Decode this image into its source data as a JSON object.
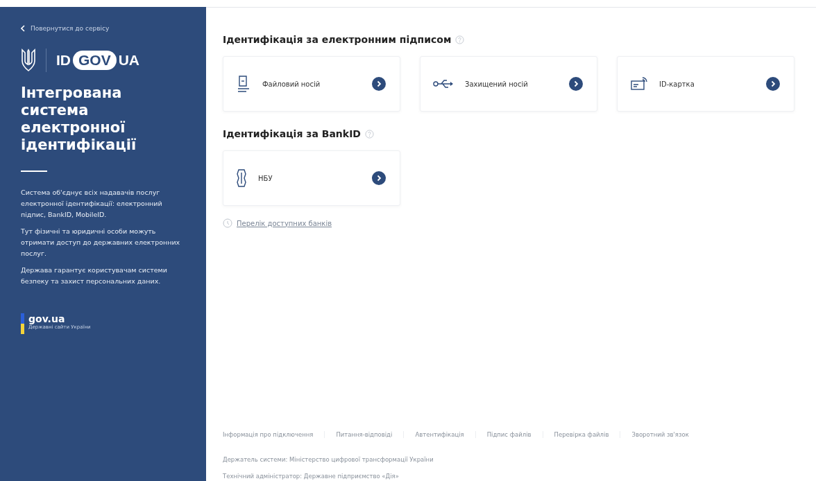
{
  "sidebar": {
    "back_link": "Повернутися до сервісу",
    "logo": {
      "left": "ID",
      "middle": "GOV",
      "right": "UA"
    },
    "title": "Інтегрована система електронної ідентифікації",
    "paragraphs": [
      "Система об'єднує всіх надавачів послуг електронної ідентифікації: електронний підпис, BankID, MobileID.",
      "Тут фізичні та юридичні особи можуть отримати доступ до державних електронних послуг.",
      "Держава гарантує користувачам системи безпеку та захист персональних даних."
    ],
    "gov": {
      "name": "gov.ua",
      "caption": "Державні сайти України"
    }
  },
  "sections": [
    {
      "title": "Ідентифікація за електронним підписом",
      "options": [
        {
          "kind": "file",
          "label": "Файловий носій"
        },
        {
          "kind": "usb",
          "label": "Захищений носій"
        },
        {
          "kind": "card",
          "label": "ID-картка"
        }
      ]
    },
    {
      "title": "Ідентифікація за BankID",
      "options": [
        {
          "kind": "bank",
          "label": "НБУ"
        }
      ],
      "link": "Перелік доступних банків"
    }
  ],
  "footer": {
    "links": [
      "Інформація про підключення",
      "Питання-відповіді",
      "Автентифікація",
      "Підпис файлів",
      "Перевірка файлів",
      "Зворотний зв'язок"
    ],
    "notes": [
      "Держатель системи: Міністерство цифрової трансформації України",
      "Технічний адміністратор: Державне підприємство «Дія»"
    ]
  }
}
